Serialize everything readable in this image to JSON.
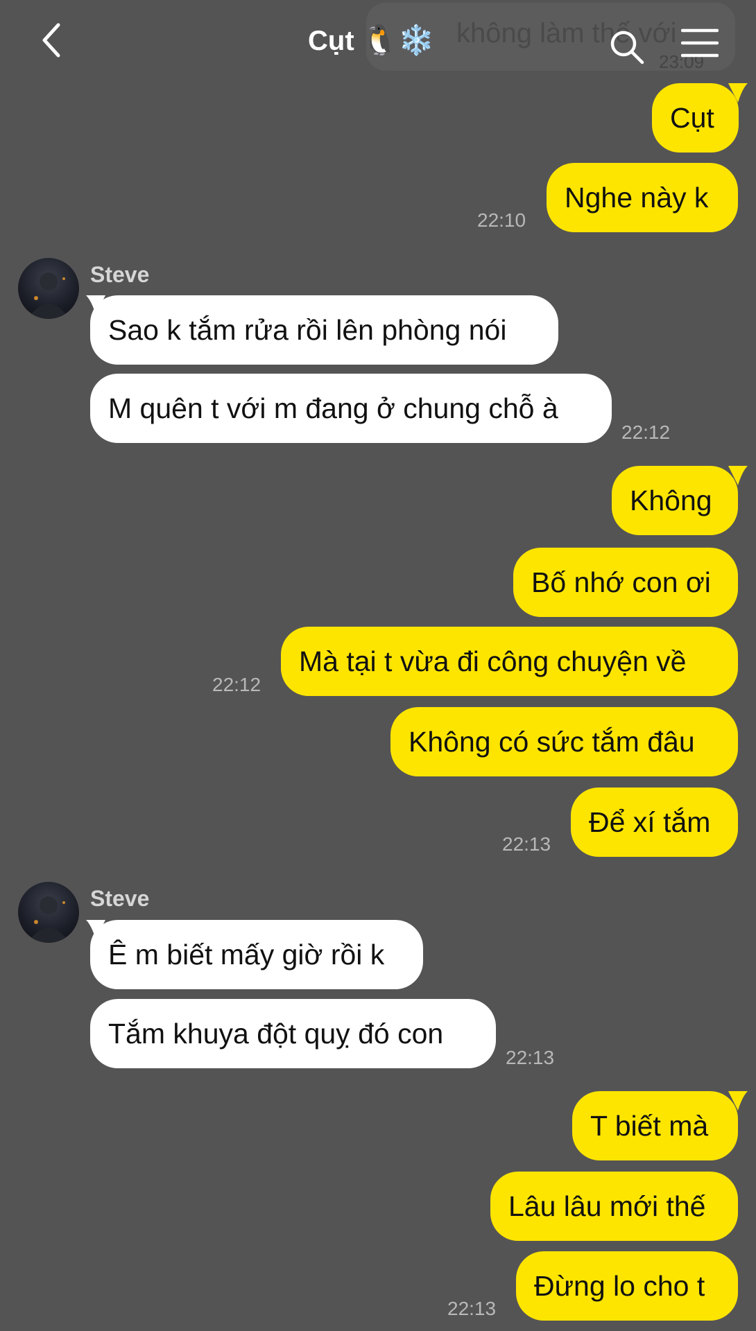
{
  "header": {
    "title": "Cụt",
    "title_emoji": "🐧❄️",
    "preview_text": "không làm thế với",
    "preview_time": "23:09"
  },
  "messages": {
    "m1": "Cụt",
    "m2": "Nghe này k",
    "t1": "22:10",
    "sender1": "Steve",
    "m3": "Sao k tắm rửa rồi lên phòng nói",
    "m4": "M quên t với m đang ở chung chỗ à",
    "t2": "22:12",
    "m5": "Không",
    "m6": "Bố nhớ con ơi",
    "m7": "Mà tại t vừa đi công chuyện về",
    "t3": "22:12",
    "m8": "Không có sức tắm đâu",
    "m9": "Để xí tắm",
    "t4": "22:13",
    "sender2": "Steve",
    "m10": "Ê m biết mấy giờ rồi k",
    "m11": "Tắm khuya đột quỵ đó con",
    "t5": "22:13",
    "m12": "T biết mà",
    "m13": "Lâu lâu mới thế",
    "m14": "Đừng lo cho t",
    "t6": "22:13"
  },
  "colors": {
    "background": "#555455",
    "my_bubble": "#fee500",
    "their_bubble": "#ffffff",
    "timestamp": "#b8b8b8"
  },
  "icons": [
    "back-chevron-icon",
    "search-icon",
    "menu-icon"
  ]
}
